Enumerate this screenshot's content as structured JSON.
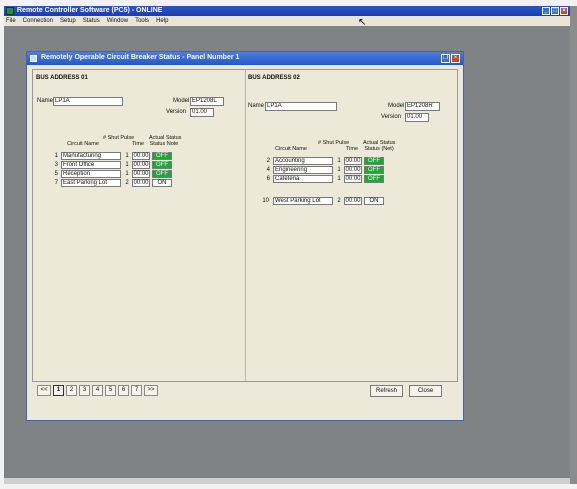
{
  "app": {
    "title": "Remote Controller Software (PC5) - ONLINE",
    "menu": [
      "File",
      "Connection",
      "Setup",
      "Status",
      "Window",
      "Tools",
      "Help"
    ]
  },
  "dialog": {
    "title": "Remotely Operable Circuit Breaker Status - Panel Number 1",
    "buttons": {
      "refresh": "Refresh",
      "close": "Close"
    },
    "pager": [
      "<<",
      "1",
      "2",
      "3",
      "4",
      "5",
      "6",
      "7",
      ">>"
    ],
    "headers": {
      "name": "Circuit Name",
      "pulse": "# Shut Pulse",
      "time": "Time",
      "status": "Actual Status"
    }
  },
  "panels": [
    {
      "address_label": "BUS ADDRESS 01",
      "name_label": "Name",
      "name_value": "LP1A",
      "model_label": "Model",
      "model_value": "EP1208L",
      "version_label": "Version",
      "version_value": "01.00",
      "status_header": "Status Note",
      "circuits": [
        {
          "num": "1",
          "name": "Manufacturing",
          "pulse": "1",
          "time": "00:00",
          "status": "OFF"
        },
        {
          "num": "3",
          "name": "Front Office",
          "pulse": "1",
          "time": "00:00",
          "status": "OFF"
        },
        {
          "num": "5",
          "name": "Reception",
          "pulse": "1",
          "time": "00:00",
          "status": "OFF"
        },
        {
          "num": "7",
          "name": "East Parking Lot",
          "pulse": "2",
          "time": "00:00",
          "status": "ON"
        }
      ]
    },
    {
      "address_label": "BUS ADDRESS 02",
      "name_label": "Name",
      "name_value": "LP1A",
      "model_label": "Model",
      "model_value": "EP1208R",
      "version_label": "Version",
      "version_value": "01.00",
      "status_header": "Status (Net)",
      "circuits": [
        {
          "num": "2",
          "name": "Accounting",
          "pulse": "1",
          "time": "00:00",
          "status": "OFF"
        },
        {
          "num": "4",
          "name": "Engineering",
          "pulse": "1",
          "time": "00:00",
          "status": "OFF"
        },
        {
          "num": "6",
          "name": "Cafeteria",
          "pulse": "1",
          "time": "00:00",
          "status": "OFF"
        },
        {
          "num": "10",
          "name": "West Parking Lot",
          "pulse": "2",
          "time": "00:00",
          "status": "ON"
        }
      ]
    }
  ],
  "colors": {
    "status_off": "#1fa83a",
    "title_bar": "#2456c8",
    "window_face": "#ece9d8"
  },
  "icons": [
    "app-icon",
    "dialog-icon",
    "minimize-icon",
    "maximize-icon",
    "close-icon",
    "cursor-icon"
  ]
}
